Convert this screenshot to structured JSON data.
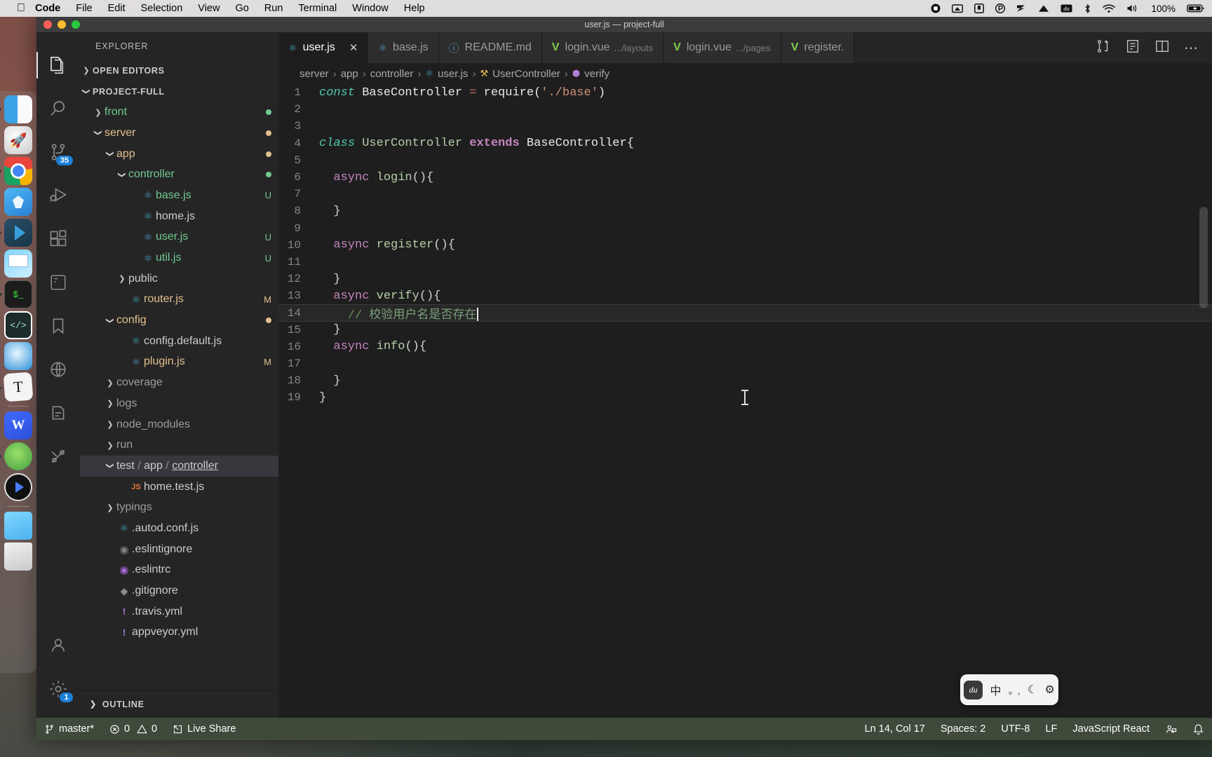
{
  "menubar": {
    "apple": "&#63743;",
    "items": [
      {
        "label": "Code",
        "bold": true
      },
      {
        "label": "File",
        "bold": false
      },
      {
        "label": "Edit",
        "bold": false
      },
      {
        "label": "Selection",
        "bold": false
      },
      {
        "label": "View",
        "bold": false
      },
      {
        "label": "Go",
        "bold": false
      },
      {
        "label": "Run",
        "bold": false
      },
      {
        "label": "Terminal",
        "bold": false
      },
      {
        "label": "Window",
        "bold": false
      },
      {
        "label": "Help",
        "bold": false
      }
    ],
    "right_icons": [
      "record-icon",
      "screenshot-icon",
      "bookmark-icon",
      "popclip-icon",
      "snipaste-icon",
      "triangle-icon",
      "baidu-icon",
      "bluetooth-icon",
      "wifi-icon",
      "volume-icon"
    ],
    "battery_percent": "100%"
  },
  "dock": {
    "items": [
      {
        "name": "finder",
        "running": true
      },
      {
        "name": "launchpad",
        "running": false
      },
      {
        "name": "chrome",
        "running": true
      },
      {
        "name": "sketch",
        "running": false
      },
      {
        "name": "vscode",
        "running": true
      },
      {
        "name": "keynote",
        "running": false
      },
      {
        "name": "terminal",
        "running": true
      },
      {
        "name": "code-editor",
        "running": false
      },
      {
        "name": "safari",
        "running": false
      },
      {
        "name": "typora",
        "running": true
      },
      {
        "name": "wps",
        "running": false
      },
      {
        "name": "green-app",
        "running": true
      },
      {
        "name": "media-player",
        "running": false
      },
      {
        "name": "downloads-folder",
        "running": false
      },
      {
        "name": "trash",
        "running": false
      }
    ]
  },
  "window": {
    "title": "user.js — project-full"
  },
  "activitybar": {
    "items": [
      {
        "name": "explorer",
        "active": true,
        "badge": null
      },
      {
        "name": "search",
        "active": false,
        "badge": null
      },
      {
        "name": "source-control",
        "active": false,
        "badge": "35"
      },
      {
        "name": "debug",
        "active": false,
        "badge": null
      },
      {
        "name": "extensions",
        "active": false,
        "badge": null
      },
      {
        "name": "remote",
        "active": false,
        "badge": null
      },
      {
        "name": "bookmarks",
        "active": false,
        "badge": null
      },
      {
        "name": "browser-preview",
        "active": false,
        "badge": null
      },
      {
        "name": "todo",
        "active": false,
        "badge": null
      },
      {
        "name": "git-graph",
        "active": false,
        "badge": null
      }
    ],
    "bottom": [
      {
        "name": "accounts",
        "active": false,
        "badge": null
      },
      {
        "name": "settings",
        "active": false,
        "badge": "1"
      }
    ]
  },
  "sidebar": {
    "title": "EXPLORER",
    "outline_label": "OUTLINE",
    "tree": [
      {
        "label": "OPEN EDITORS",
        "indent": 0,
        "chev": "right",
        "icon": null,
        "color": "c-white",
        "header": true,
        "git": null,
        "dot": null,
        "selected": false
      },
      {
        "label": "PROJECT-FULL",
        "indent": 0,
        "chev": "down",
        "icon": null,
        "color": "c-white",
        "header": true,
        "git": null,
        "dot": null,
        "selected": false
      },
      {
        "label": "front",
        "indent": 1,
        "chev": "right",
        "icon": null,
        "color": "c-green",
        "header": false,
        "git": null,
        "dot": "#73c991",
        "selected": false
      },
      {
        "label": "server",
        "indent": 1,
        "chev": "down",
        "icon": null,
        "color": "c-yellow",
        "header": false,
        "git": null,
        "dot": "#e2c08d",
        "selected": false
      },
      {
        "label": "app",
        "indent": 2,
        "chev": "down",
        "icon": null,
        "color": "c-yellow",
        "header": false,
        "git": null,
        "dot": "#e2c08d",
        "selected": false
      },
      {
        "label": "controller",
        "indent": 3,
        "chev": "down",
        "icon": null,
        "color": "c-green",
        "header": false,
        "git": null,
        "dot": "#73c991",
        "selected": false
      },
      {
        "label": "base.js",
        "indent": 4,
        "chev": "none",
        "icon": "react",
        "color": "c-green",
        "header": false,
        "git": "U",
        "selected": false
      },
      {
        "label": "home.js",
        "indent": 4,
        "chev": "none",
        "icon": "react",
        "color": "c-white",
        "header": false,
        "git": null,
        "selected": false
      },
      {
        "label": "user.js",
        "indent": 4,
        "chev": "none",
        "icon": "react",
        "color": "c-green",
        "header": false,
        "git": "U",
        "selected": false
      },
      {
        "label": "util.js",
        "indent": 4,
        "chev": "none",
        "icon": "react",
        "color": "c-green",
        "header": false,
        "git": "U",
        "selected": false
      },
      {
        "label": "public",
        "indent": 3,
        "chev": "right",
        "icon": null,
        "color": "c-white",
        "header": false,
        "git": null,
        "selected": false
      },
      {
        "label": "router.js",
        "indent": 3,
        "chev": "none",
        "icon": "react",
        "color": "c-yellow",
        "header": false,
        "git": "M",
        "selected": false
      },
      {
        "label": "config",
        "indent": 2,
        "chev": "down",
        "icon": null,
        "color": "c-yellow",
        "header": false,
        "git": null,
        "dot": "#e2c08d",
        "selected": false
      },
      {
        "label": "config.default.js",
        "indent": 3,
        "chev": "none",
        "icon": "react",
        "color": "c-white",
        "header": false,
        "git": null,
        "selected": false
      },
      {
        "label": "plugin.js",
        "indent": 3,
        "chev": "none",
        "icon": "react",
        "color": "c-yellow",
        "header": false,
        "git": "M",
        "selected": false
      },
      {
        "label": "coverage",
        "indent": 2,
        "chev": "right",
        "icon": null,
        "color": "c-grey",
        "header": false,
        "git": null,
        "selected": false
      },
      {
        "label": "logs",
        "indent": 2,
        "chev": "right",
        "icon": null,
        "color": "c-grey",
        "header": false,
        "git": null,
        "selected": false
      },
      {
        "label": "node_modules",
        "indent": 2,
        "chev": "right",
        "icon": null,
        "color": "c-grey",
        "header": false,
        "git": null,
        "selected": false
      },
      {
        "label": "run",
        "indent": 2,
        "chev": "right",
        "icon": null,
        "color": "c-grey",
        "header": false,
        "git": null,
        "selected": false
      },
      {
        "label": "test / app / controller",
        "indent": 2,
        "chev": "down",
        "icon": null,
        "color": "c-white",
        "header": false,
        "git": null,
        "selected": true,
        "compact": true
      },
      {
        "label": "home.test.js",
        "indent": 3,
        "chev": "none",
        "icon": "js",
        "color": "c-white",
        "header": false,
        "git": null,
        "selected": false
      },
      {
        "label": "typings",
        "indent": 2,
        "chev": "right",
        "icon": null,
        "color": "c-grey",
        "header": false,
        "git": null,
        "selected": false
      },
      {
        "label": ".autod.conf.js",
        "indent": 2,
        "chev": "none",
        "icon": "react",
        "color": "c-white",
        "header": false,
        "git": null,
        "selected": false
      },
      {
        "label": ".eslintignore",
        "indent": 2,
        "chev": "none",
        "icon": "eslint-grey",
        "color": "c-white",
        "header": false,
        "git": null,
        "selected": false
      },
      {
        "label": ".eslintrc",
        "indent": 2,
        "chev": "none",
        "icon": "eslint",
        "color": "c-white",
        "header": false,
        "git": null,
        "selected": false
      },
      {
        "label": ".gitignore",
        "indent": 2,
        "chev": "none",
        "icon": "git",
        "color": "c-white",
        "header": false,
        "git": null,
        "selected": false
      },
      {
        "label": ".travis.yml",
        "indent": 2,
        "chev": "none",
        "icon": "yml",
        "color": "c-white",
        "header": false,
        "git": null,
        "selected": false
      },
      {
        "label": "appveyor.yml",
        "indent": 2,
        "chev": "none",
        "icon": "yml",
        "color": "c-white",
        "header": false,
        "git": null,
        "selected": false
      }
    ]
  },
  "tabs": [
    {
      "label": "user.js",
      "sub": "",
      "icon": "react",
      "active": true,
      "closable": true
    },
    {
      "label": "base.js",
      "sub": "",
      "icon": "react",
      "active": false,
      "closable": false
    },
    {
      "label": "README.md",
      "sub": "",
      "icon": "info",
      "active": false,
      "closable": false
    },
    {
      "label": "login.vue",
      "sub": ".../layouts",
      "icon": "vue",
      "active": false,
      "closable": false
    },
    {
      "label": "login.vue",
      "sub": ".../pages",
      "icon": "vue",
      "active": false,
      "closable": false
    },
    {
      "label": "register.",
      "sub": "",
      "icon": "vue",
      "active": false,
      "closable": false
    }
  ],
  "tab_actions": [
    "split-diff-icon",
    "open-changes-icon",
    "split-editor-icon",
    "more-actions-icon"
  ],
  "breadcrumb": [
    {
      "label": "server",
      "icon": null
    },
    {
      "label": "app",
      "icon": null
    },
    {
      "label": "controller",
      "icon": null
    },
    {
      "label": "user.js",
      "icon": "react"
    },
    {
      "label": "UserController",
      "icon": "class"
    },
    {
      "label": "verify",
      "icon": "method"
    }
  ],
  "code": {
    "lines": [
      {
        "num": "1",
        "highlight": false,
        "tokens": [
          {
            "t": "const ",
            "c": "k-kw"
          },
          {
            "t": "BaseController ",
            "c": "k-plain"
          },
          {
            "t": "= ",
            "c": "k-op"
          },
          {
            "t": "require(",
            "c": "k-plain"
          },
          {
            "t": "'./base'",
            "c": "k-str"
          },
          {
            "t": ")",
            "c": "k-plain"
          }
        ]
      },
      {
        "num": "2",
        "highlight": false,
        "tokens": []
      },
      {
        "num": "3",
        "highlight": false,
        "tokens": []
      },
      {
        "num": "4",
        "highlight": false,
        "tokens": [
          {
            "t": "class ",
            "c": "k-kw"
          },
          {
            "t": "UserController ",
            "c": "k-cls"
          },
          {
            "t": "extends ",
            "c": "k-ext"
          },
          {
            "t": "BaseController{",
            "c": "k-plain"
          }
        ]
      },
      {
        "num": "5",
        "highlight": false,
        "tokens": []
      },
      {
        "num": "6",
        "highlight": false,
        "tokens": [
          {
            "t": "  async ",
            "c": "k-async"
          },
          {
            "t": "login",
            "c": "k-fname"
          },
          {
            "t": "(){",
            "c": "k-punc"
          }
        ]
      },
      {
        "num": "7",
        "highlight": false,
        "tokens": []
      },
      {
        "num": "8",
        "highlight": false,
        "tokens": [
          {
            "t": "  }",
            "c": "k-punc"
          }
        ]
      },
      {
        "num": "9",
        "highlight": false,
        "tokens": []
      },
      {
        "num": "10",
        "highlight": false,
        "tokens": [
          {
            "t": "  async ",
            "c": "k-async"
          },
          {
            "t": "register",
            "c": "k-fname"
          },
          {
            "t": "(){",
            "c": "k-punc"
          }
        ]
      },
      {
        "num": "11",
        "highlight": false,
        "tokens": []
      },
      {
        "num": "12",
        "highlight": false,
        "tokens": [
          {
            "t": "  }",
            "c": "k-punc"
          }
        ]
      },
      {
        "num": "13",
        "highlight": false,
        "tokens": [
          {
            "t": "  async ",
            "c": "k-async"
          },
          {
            "t": "verify",
            "c": "k-fname"
          },
          {
            "t": "(){",
            "c": "k-punc"
          }
        ]
      },
      {
        "num": "14",
        "highlight": true,
        "tokens": [
          {
            "t": "    // ",
            "c": "k-com"
          },
          {
            "t": "校验用户名是否存在",
            "c": "k-cn"
          }
        ],
        "caret": true
      },
      {
        "num": "15",
        "highlight": false,
        "tokens": [
          {
            "t": "  }",
            "c": "k-punc"
          }
        ]
      },
      {
        "num": "16",
        "highlight": false,
        "tokens": [
          {
            "t": "  async ",
            "c": "k-async"
          },
          {
            "t": "info",
            "c": "k-fname"
          },
          {
            "t": "(){",
            "c": "k-punc"
          }
        ]
      },
      {
        "num": "17",
        "highlight": false,
        "tokens": []
      },
      {
        "num": "18",
        "highlight": false,
        "tokens": [
          {
            "t": "  }",
            "c": "k-punc"
          }
        ]
      },
      {
        "num": "19",
        "highlight": false,
        "tokens": [
          {
            "t": "}",
            "c": "k-punc"
          }
        ]
      }
    ]
  },
  "ime": {
    "logo": "du",
    "mode": "中",
    "punct": "。,",
    "moon": "&#9790;",
    "gear": "&#9881;"
  },
  "statusbar": {
    "branch": "master*",
    "errors": "0",
    "warnings": "0",
    "live_share": "Live Share",
    "position": "Ln 14, Col 17",
    "spaces": "Spaces: 2",
    "encoding": "UTF-8",
    "eol": "LF",
    "language": "JavaScript React",
    "right_icons": [
      "feedback-icon",
      "bell-icon"
    ]
  }
}
